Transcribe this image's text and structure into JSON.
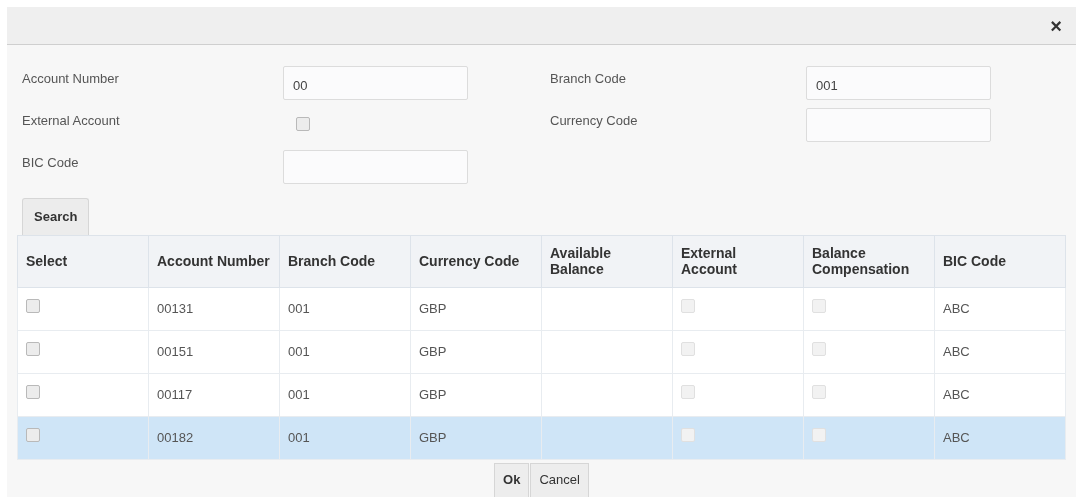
{
  "dialog": {
    "close": "×"
  },
  "form": [
    {
      "label": "Account Number",
      "kind": "text",
      "value": "00"
    },
    {
      "label": "Branch Code",
      "kind": "text",
      "value": "001"
    },
    {
      "label": "External Account",
      "kind": "checkbox",
      "checked": false
    },
    {
      "label": "Currency Code",
      "kind": "text"
    },
    {
      "label": "BIC Code",
      "kind": "text"
    }
  ],
  "search_tab": "Search",
  "table": {
    "columns": [
      "Select",
      "Account Number",
      "Branch Code",
      "Currency Code",
      "Available Balance",
      "External Account",
      "Balance Compensation",
      "BIC Code"
    ],
    "rows": [
      {
        "selected": false,
        "checked": false,
        "account_number": "00131",
        "branch_code": "001",
        "currency_code": "GBP",
        "external_account": false,
        "balance_compensation": false,
        "bic_code": "ABC"
      },
      {
        "selected": false,
        "checked": false,
        "account_number": "00151",
        "branch_code": "001",
        "currency_code": "GBP",
        "external_account": false,
        "balance_compensation": false,
        "bic_code": "ABC"
      },
      {
        "selected": false,
        "checked": false,
        "account_number": "00117",
        "branch_code": "001",
        "currency_code": "GBP",
        "external_account": false,
        "balance_compensation": false,
        "bic_code": "ABC"
      },
      {
        "selected": true,
        "checked": false,
        "account_number": "00182",
        "branch_code": "001",
        "currency_code": "GBP",
        "external_account": false,
        "balance_compensation": false,
        "bic_code": "ABC"
      }
    ]
  },
  "buttons": [
    "Ok",
    "Cancel"
  ]
}
